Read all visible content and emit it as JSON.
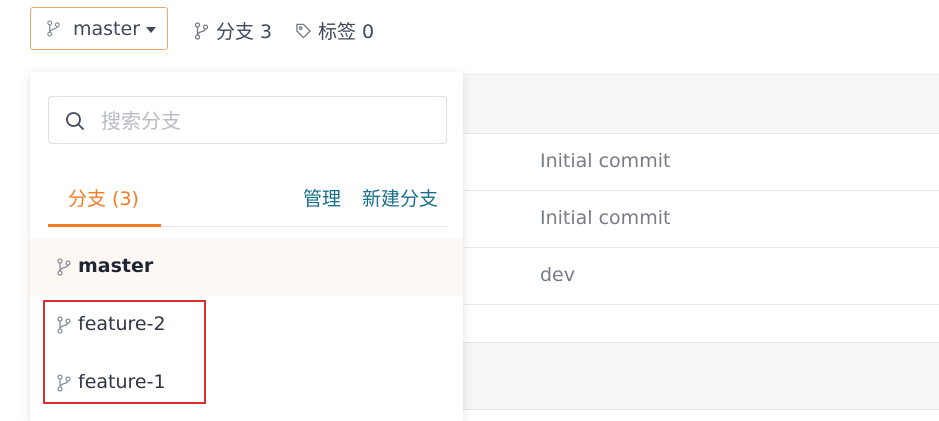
{
  "repo_bar": {
    "current_branch": "master",
    "branches_stat": "分支 3",
    "tags_stat": "标签 0"
  },
  "commits": [
    {
      "message": "Initial commit"
    },
    {
      "message": "Initial commit"
    },
    {
      "message": "dev"
    }
  ],
  "dropdown": {
    "search_placeholder": "搜索分支",
    "search_value": "",
    "active_tab": "分支 (3)",
    "manage_label": "管理",
    "new_branch_label": "新建分支",
    "branches": [
      {
        "name": "master",
        "selected": true
      },
      {
        "name": "feature-2",
        "selected": false
      },
      {
        "name": "feature-1",
        "selected": false
      }
    ]
  },
  "colors": {
    "accent": "#f27c24",
    "link": "#1b6e8c",
    "highlight_box": "#d9302c"
  },
  "icons": {
    "branch": "git-branch-icon",
    "tag": "tag-icon",
    "search": "search-icon",
    "caret": "caret-down-icon"
  }
}
